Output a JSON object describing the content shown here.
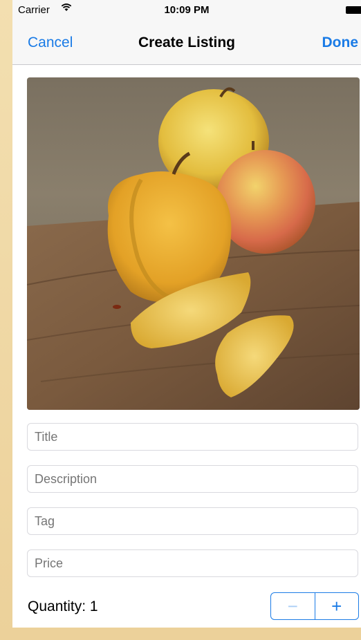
{
  "status_bar": {
    "carrier": "Carrier",
    "time": "10:09 PM"
  },
  "nav": {
    "cancel_label": "Cancel",
    "title": "Create Listing",
    "done_label": "Done"
  },
  "form": {
    "title_placeholder": "Title",
    "description_placeholder": "Description",
    "tag_placeholder": "Tag",
    "price_placeholder": "Price"
  },
  "quantity": {
    "label": "Quantity: 1",
    "minus": "−",
    "plus": "+"
  },
  "colors": {
    "accent": "#1a7be6",
    "accent_disabled": "#a9cdf5"
  },
  "icons": {
    "wifi": "wifi-icon",
    "battery": "battery-icon"
  }
}
